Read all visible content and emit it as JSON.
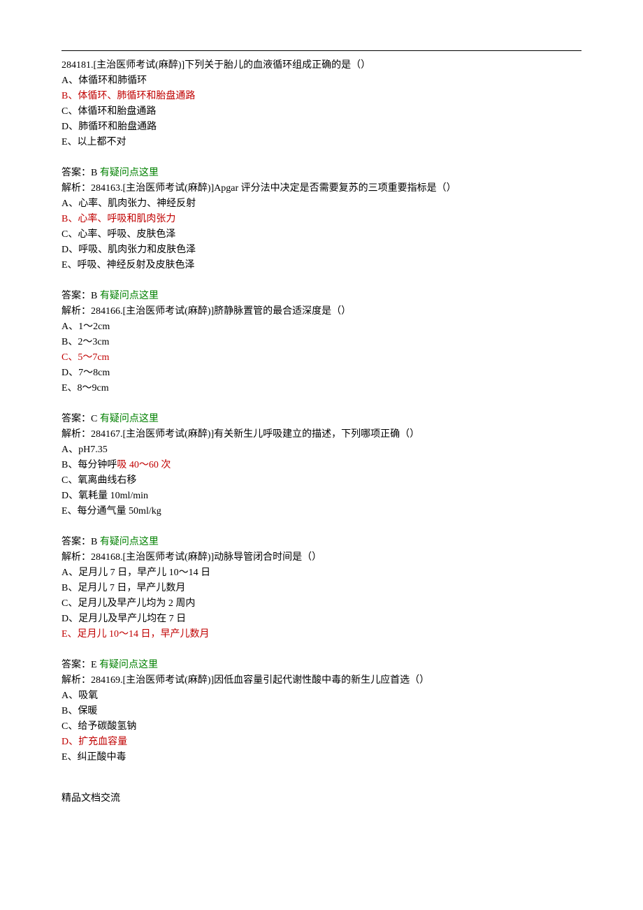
{
  "questions": [
    {
      "stem": "284181.[主治医师考试(麻醉)]下列关于胎儿的血液循环组成正确的是（）",
      "options": [
        {
          "text": "A、体循环和肺循环",
          "correct": false
        },
        {
          "text": "B、体循环、肺循环和胎盘通路",
          "correct": true
        },
        {
          "text": "C、体循环和胎盘通路",
          "correct": false
        },
        {
          "text": "D、肺循环和胎盘通路",
          "correct": false
        },
        {
          "text": "E、以上都不对",
          "correct": false
        }
      ],
      "answer_label": "答案：B",
      "doubt_label": "有疑问点这里",
      "analysis_prefix": "解析："
    },
    {
      "stem": "284163.[主治医师考试(麻醉)]Apgar 评分法中决定是否需要复苏的三项重要指标是（）",
      "options": [
        {
          "text": "A、心率、肌肉张力、神经反射",
          "correct": false
        },
        {
          "text": "B、心率、呼吸和肌肉张力",
          "correct": true
        },
        {
          "text": "C、心率、呼吸、皮肤色泽",
          "correct": false
        },
        {
          "text": "D、呼吸、肌肉张力和皮肤色泽",
          "correct": false
        },
        {
          "text": "E、呼吸、神经反射及皮肤色泽",
          "correct": false
        }
      ],
      "answer_label": "答案：B",
      "doubt_label": "有疑问点这里",
      "analysis_prefix": "解析："
    },
    {
      "stem": "284166.[主治医师考试(麻醉)]脐静脉置管的最合适深度是（）",
      "options": [
        {
          "text": "A、1～2cm",
          "correct": false
        },
        {
          "text": "B、2～3cm",
          "correct": false
        },
        {
          "text": "C、5～7cm",
          "correct": true
        },
        {
          "text": "D、7～8cm",
          "correct": false
        },
        {
          "text": "E、8～9cm",
          "correct": false
        }
      ],
      "answer_label": "答案：C",
      "doubt_label": "有疑问点这里",
      "analysis_prefix": "解析："
    },
    {
      "stem": "284167.[主治医师考试(麻醉)]有关新生儿呼吸建立的描述，下列哪项正确（）",
      "options": [
        {
          "text": "A、pH7.35",
          "correct": false
        },
        {
          "prefix": "B、每分钟呼",
          "highlight": "吸 40～60 次",
          "correct": true
        },
        {
          "text": "C、氧离曲线右移",
          "correct": false
        },
        {
          "text": "D、氧耗量 10ml/min",
          "correct": false
        },
        {
          "text": "E、每分通气量 50ml/kg",
          "correct": false
        }
      ],
      "answer_label": "答案：B",
      "doubt_label": "有疑问点这里",
      "analysis_prefix": "解析："
    },
    {
      "stem": "284168.[主治医师考试(麻醉)]动脉导管闭合时间是（）",
      "options": [
        {
          "text": "A、足月儿 7 日，早产儿 10～14 日",
          "correct": false
        },
        {
          "text": "B、足月儿 7 日，早产儿数月",
          "correct": false
        },
        {
          "text": "C、足月儿及早产儿均为 2 周内",
          "correct": false
        },
        {
          "text": "D、足月儿及早产儿均在 7 日",
          "correct": false
        },
        {
          "text": "E、足月儿 10～14 日，早产儿数月",
          "correct": true
        }
      ],
      "answer_label": "答案：E",
      "doubt_label": "有疑问点这里",
      "analysis_prefix": "解析："
    },
    {
      "stem": "284169.[主治医师考试(麻醉)]因低血容量引起代谢性酸中毒的新生儿应首选（）",
      "options": [
        {
          "text": "A、吸氧",
          "correct": false
        },
        {
          "text": "B、保暖",
          "correct": false
        },
        {
          "text": "C、给予碳酸氢钠",
          "correct": false
        },
        {
          "text": "D、扩充血容量",
          "correct": true
        },
        {
          "text": "E、纠正酸中毒",
          "correct": false
        }
      ],
      "answer_label": "",
      "doubt_label": "",
      "analysis_prefix": ""
    }
  ],
  "footer": "精品文档交流"
}
